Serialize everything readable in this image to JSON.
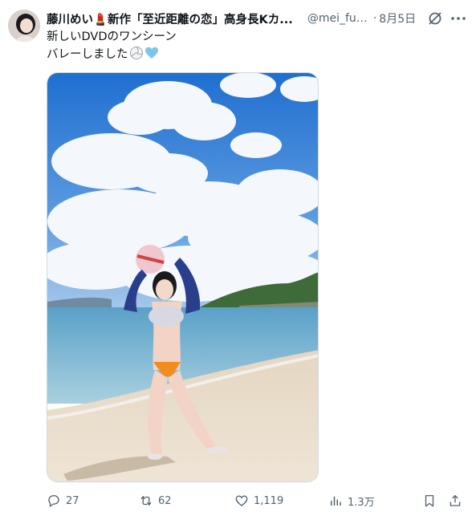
{
  "post": {
    "author_name": "藤川めい💄新作「至近距離の恋」高身長Kカ...",
    "handle": "@mei_fuj...",
    "separator": "·",
    "date": "8月5日",
    "text_line1": "新しいDVDのワンシーン",
    "text_line2": "バレーしました"
  },
  "actions": {
    "replies": "27",
    "reposts": "62",
    "likes": "1,119",
    "views": "1.3万"
  },
  "icons": {
    "avatar": "avatar",
    "grok": "grok-icon",
    "more": "more-icon",
    "reply": "reply-icon",
    "repost": "repost-icon",
    "like": "like-icon",
    "views": "views-icon",
    "bookmark": "bookmark-icon",
    "share": "share-icon"
  },
  "colors": {
    "text": "#0f1419",
    "muted": "#536471",
    "border": "#cfd9de",
    "sky": "#2d77d3",
    "sea": "#5fa6c9",
    "sand": "#eadfce"
  }
}
